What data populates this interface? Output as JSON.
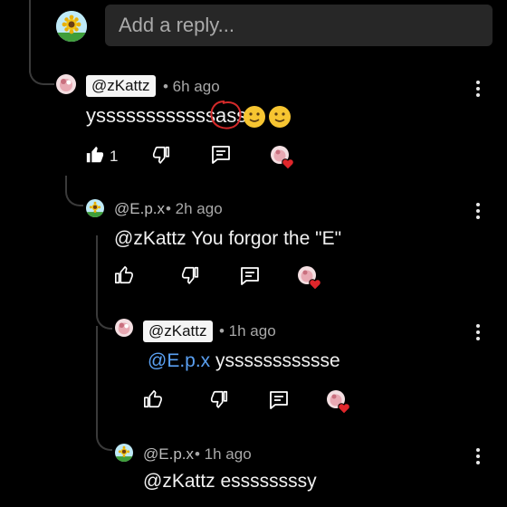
{
  "reply_input": {
    "placeholder": "Add a reply..."
  },
  "comments": [
    {
      "handle": "@zKattz",
      "meta": "• 6h ago",
      "text": "yssssssssssssass",
      "emojis": [
        "slightly-smiling-face",
        "slightly-smiling-face"
      ],
      "likes": "1",
      "highlight_marker": "red-circle"
    },
    {
      "handle": "@E.p.x",
      "meta": "• 2h ago",
      "text": "@zKattz You forgor the \"E\""
    },
    {
      "handle": "@zKattz",
      "meta": "• 1h ago",
      "mention": "@E.p.x",
      "text": " yssssssssssse"
    },
    {
      "handle": "@E.p.x",
      "meta": "• 1h ago",
      "text": "@zKattz essssssssy"
    }
  ],
  "icons": {
    "like": "thumbs-up-icon",
    "dislike": "thumbs-down-icon",
    "reply": "reply-icon",
    "creator_heart": "creator-heart-icon",
    "menu": "more-vert-icon"
  },
  "colors": {
    "background": "#000000",
    "link": "#5aa0f2",
    "heart": "#e0262b",
    "marker": "#d42a2a"
  }
}
